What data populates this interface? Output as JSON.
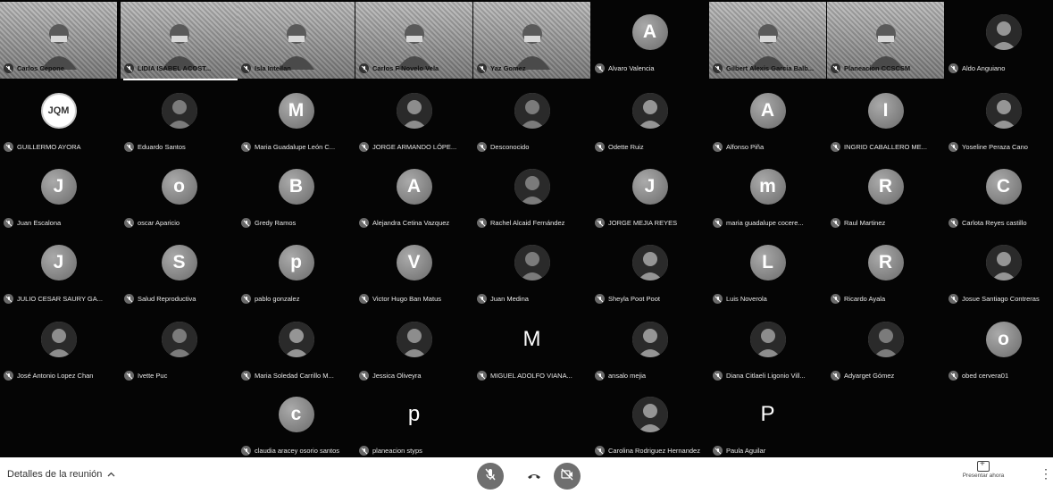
{
  "participants": [
    {
      "name": "Carlos Cepone",
      "type": "video"
    },
    {
      "name": "LIDIA ISABEL ACOST...",
      "type": "video"
    },
    {
      "name": "Isla Intellan",
      "type": "video"
    },
    {
      "name": "Carlos F Novelo Vela",
      "type": "video"
    },
    {
      "name": "Yaz Gomez",
      "type": "video"
    },
    {
      "name": "Alvaro Valencia",
      "type": "initial",
      "initial": "A"
    },
    {
      "name": "Gilbert Alexis Garcia Balb...",
      "type": "video"
    },
    {
      "name": "Planeacion CCSCSM",
      "type": "video"
    },
    {
      "name": "Aldo Anguiano",
      "type": "photo"
    },
    {
      "name": "GUILLERMO AYORA",
      "type": "logo",
      "initial": "JQM"
    },
    {
      "name": "Eduardo Santos",
      "type": "photo"
    },
    {
      "name": "Maria Guadalupe León C...",
      "type": "initial",
      "initial": "M"
    },
    {
      "name": "JORGE ARMANDO LÓPE...",
      "type": "photo"
    },
    {
      "name": "Desconocido",
      "type": "photo"
    },
    {
      "name": "Odette Ruiz",
      "type": "photo"
    },
    {
      "name": "Alfonso Piña",
      "type": "initial",
      "initial": "A"
    },
    {
      "name": "INGRID CABALLERO ME...",
      "type": "initial",
      "initial": "I"
    },
    {
      "name": "Yoseline Peraza Cano",
      "type": "photo"
    },
    {
      "name": "Juan Escalona",
      "type": "initial",
      "initial": "J"
    },
    {
      "name": "oscar Aparicio",
      "type": "initial",
      "initial": "o"
    },
    {
      "name": "Gredy Ramos",
      "type": "initial",
      "initial": "B"
    },
    {
      "name": "Alejandra Cetina Vazquez",
      "type": "initial",
      "initial": "A"
    },
    {
      "name": "Rachel Alcaid Fernández",
      "type": "photo"
    },
    {
      "name": "JORGE MEJIA REYES",
      "type": "initial",
      "initial": "J"
    },
    {
      "name": "maria guadalupe cocere...",
      "type": "initial",
      "initial": "m"
    },
    {
      "name": "Raul Martinez",
      "type": "initial",
      "initial": "R"
    },
    {
      "name": "Carlota Reyes castillo",
      "type": "initial",
      "initial": "C"
    },
    {
      "name": "JULIO CESAR SAURY GA...",
      "type": "initial",
      "initial": "J"
    },
    {
      "name": "Salud Reproductiva",
      "type": "initial",
      "initial": "S"
    },
    {
      "name": "pablo gonzalez",
      "type": "initial",
      "initial": "p"
    },
    {
      "name": "Victor Hugo Ban Matus",
      "type": "initial",
      "initial": "V"
    },
    {
      "name": "Juan Medina",
      "type": "photo"
    },
    {
      "name": "Sheyla Poot Poot",
      "type": "photo"
    },
    {
      "name": "Luis Noverola",
      "type": "initial",
      "initial": "L"
    },
    {
      "name": "Ricardo Ayala",
      "type": "initial",
      "initial": "R"
    },
    {
      "name": "Josue Santiago Contreras",
      "type": "photo"
    },
    {
      "name": "José Antonio Lopez Chan",
      "type": "photo"
    },
    {
      "name": "Ivette Puc",
      "type": "photo"
    },
    {
      "name": "Maria Soledad Carrillo M...",
      "type": "photo"
    },
    {
      "name": "Jessica Oliveyra",
      "type": "photo"
    },
    {
      "name": "MIGUEL ADOLFO VIANA...",
      "type": "letter",
      "initial": "M"
    },
    {
      "name": "ansalo mejia",
      "type": "photo"
    },
    {
      "name": "Diana Citlaeli Ligonio Vill...",
      "type": "photo"
    },
    {
      "name": "Adyarget Gómez",
      "type": "photo"
    },
    {
      "name": "obed cervera01",
      "type": "initial",
      "initial": "o"
    },
    {
      "name": "claudia aracey osorio santos",
      "type": "initial",
      "initial": "c"
    },
    {
      "name": "planeacion styps",
      "type": "letter",
      "initial": "p"
    },
    {
      "name": "Carolina Rodriguez Hernandez",
      "type": "photo"
    },
    {
      "name": "Paula Aguilar",
      "type": "letter",
      "initial": "P"
    }
  ],
  "bottom_bar": {
    "meeting_details": "Detalles de la reunión",
    "present_label": "Presentar ahora"
  },
  "icons": {
    "mic": "mic-off-icon",
    "camera": "camera-off-icon",
    "end_call": "call-end-icon",
    "present": "present-screen-icon",
    "more": "more-vert-icon"
  }
}
